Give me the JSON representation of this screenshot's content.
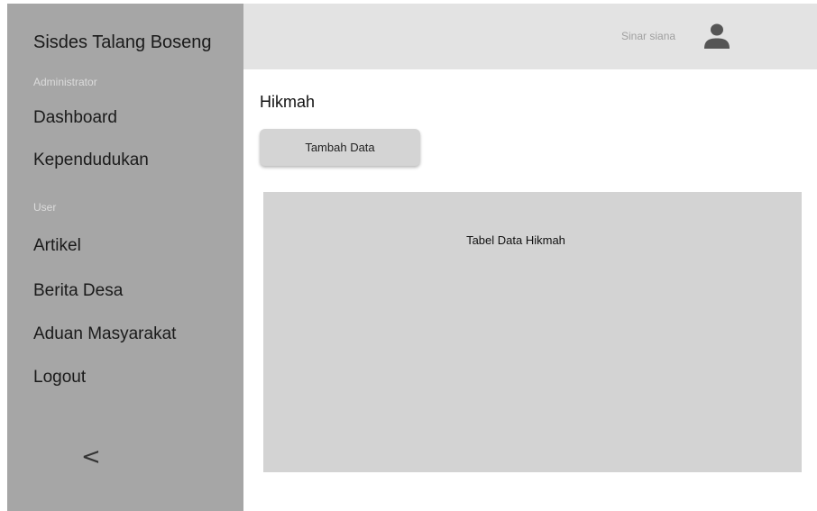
{
  "sidebar": {
    "brand": "Sisdes Talang Boseng",
    "section_admin": "Administrator",
    "section_user": "User",
    "items": [
      {
        "label": "Dashboard"
      },
      {
        "label": "Kependudukan"
      },
      {
        "label": "Artikel"
      },
      {
        "label": "Berita Desa"
      },
      {
        "label": "Aduan Masyarakat"
      },
      {
        "label": "Logout"
      }
    ],
    "collapse_label": "<",
    "collapse_icon": "chevron-left-icon"
  },
  "header": {
    "user_name": "Sinar siana",
    "avatar_icon": "user-icon"
  },
  "main": {
    "title": "Hikmah",
    "add_button_label": "Tambah Data",
    "table_placeholder": "Tabel Data Hikmah"
  },
  "colors": {
    "sidebar_bg": "#a6a6a6",
    "header_bg": "#e3e3e3",
    "panel_bg": "#d3d3d3",
    "avatar": "#555555"
  }
}
